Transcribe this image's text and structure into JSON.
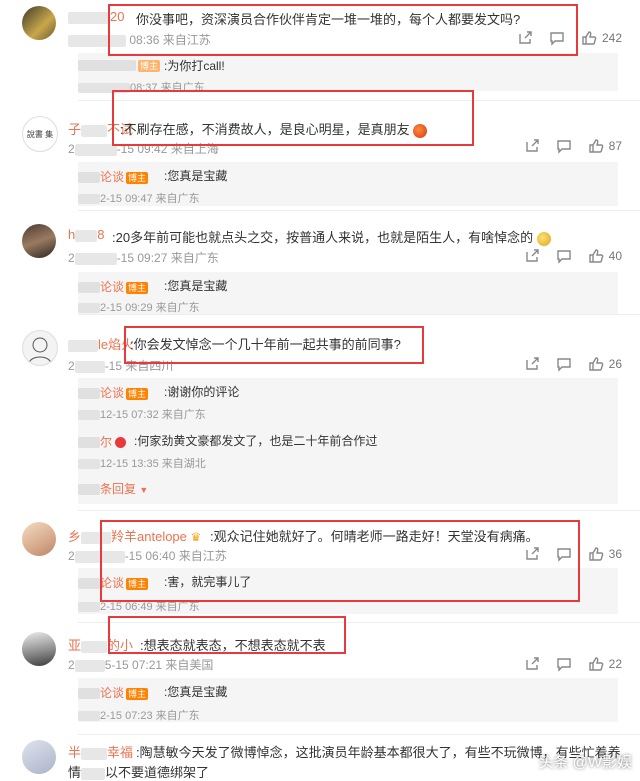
{
  "comments": [
    {
      "name_tail": "20",
      "text": "你没事吧，资深演员合作伙伴肯定一堆一堆的，每个人都要发文吗?",
      "meta": "08:36 来自江苏",
      "likes": "242",
      "reply": {
        "name_tail": "",
        "text": "为你打call!",
        "meta": "08:37 来自广东"
      }
    },
    {
      "name_head": "子",
      "name_tail": "不试",
      "text": "不刷存在感，不消费故人，是良心明星，是真朋友",
      "meta_left": "2",
      "meta": "-15 09:42 来自上海",
      "likes": "87",
      "reply": {
        "name_tail": "论谈",
        "badge": "博主",
        "text": "您真是宝藏",
        "meta": "2-15 09:47 来自广东"
      }
    },
    {
      "name_head": "h",
      "name_tail": "8",
      "text": "20多年前可能也就点头之交，按普通人来说，也就是陌生人，有啥悼念的",
      "meta_left": "2",
      "meta": "-15 09:27 来自广东",
      "likes": "40",
      "reply": {
        "name_tail": "论谈",
        "badge": "博主",
        "text": "您真是宝藏",
        "meta": "2-15 09:29 来自广东"
      }
    },
    {
      "name_tail": "le焰火",
      "text": "你会发文悼念一个几十年前一起共事的前同事?",
      "meta_left": "2",
      "meta": "-15 来自四川",
      "likes": "26",
      "replies": [
        {
          "name_tail": "论谈",
          "badge": "博主",
          "text": "谢谢你的评论",
          "meta": "12-15 07:32 来自广东"
        },
        {
          "name_tail": "尔",
          "text": "何家劲黄文豪都发文了，也是二十年前合作过",
          "meta": "12-15 13:35 来自湖北"
        }
      ],
      "more": "条回复"
    },
    {
      "name_head": "乡",
      "name_tail": "羚羊antelope",
      "text": "观众记住她就好了。何晴老师一路走好！天堂没有病痛。",
      "meta_left": "2",
      "meta": "-15 06:40 来自江苏",
      "likes": "36",
      "reply": {
        "name_tail": "论谈",
        "badge": "博主",
        "text": "害，就完事儿了",
        "meta": "2-15 06:49 来自广东"
      }
    },
    {
      "name_head": "亚",
      "name_tail": "的小 ",
      "text": "想表态就表态，不想表态就不表",
      "meta_left": "2",
      "meta": "5-15 07:21 来自美国",
      "likes": "22",
      "reply": {
        "name_tail": "论谈",
        "badge": "博主",
        "text": "您真是宝藏",
        "meta": "2-15 07:23 来自广东"
      }
    },
    {
      "name_head": "半",
      "name_tail": "幸福",
      "text": "陶慧敏今天发了微博悼念，这批演员年龄基本都很大了，有些不玩微博，有些忙着养",
      "text2_head": "情",
      "text2": "以不要道德绑架了"
    }
  ],
  "watermark": "头条 @W影娱",
  "colors": {
    "name": "#eb7350",
    "box": "#e8393c",
    "badge": "#ff8200"
  }
}
